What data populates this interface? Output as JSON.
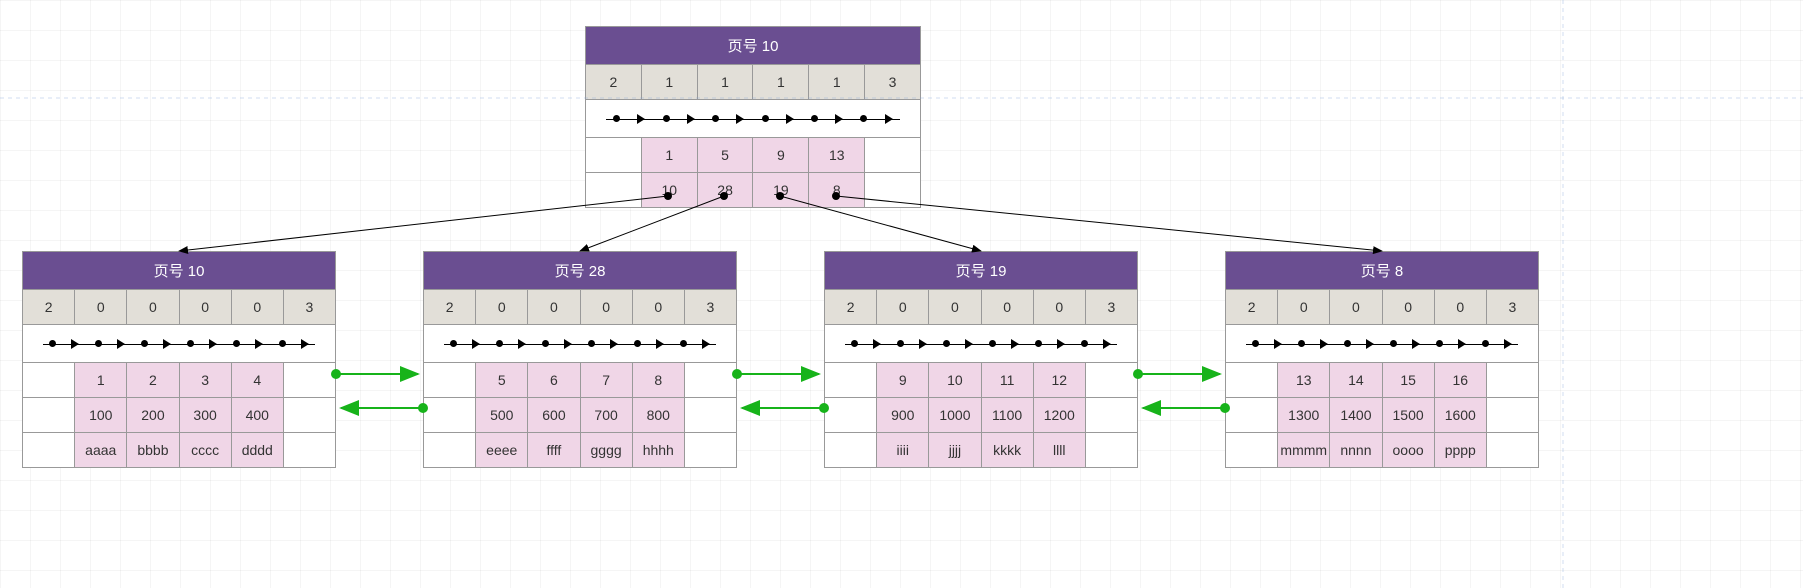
{
  "root": {
    "title": "页号 10",
    "header": [
      "2",
      "1",
      "1",
      "1",
      "1",
      "3"
    ],
    "rows": [
      [
        "",
        "1",
        "5",
        "9",
        "13",
        ""
      ],
      [
        "",
        "10",
        "28",
        "19",
        "8",
        ""
      ]
    ]
  },
  "leaves": [
    {
      "title": "页号 10",
      "header": [
        "2",
        "0",
        "0",
        "0",
        "0",
        "3"
      ],
      "rows": [
        [
          "",
          "1",
          "2",
          "3",
          "4",
          ""
        ],
        [
          "",
          "100",
          "200",
          "300",
          "400",
          ""
        ],
        [
          "",
          "aaaa",
          "bbbb",
          "cccc",
          "dddd",
          ""
        ]
      ]
    },
    {
      "title": "页号 28",
      "header": [
        "2",
        "0",
        "0",
        "0",
        "0",
        "3"
      ],
      "rows": [
        [
          "",
          "5",
          "6",
          "7",
          "8",
          ""
        ],
        [
          "",
          "500",
          "600",
          "700",
          "800",
          ""
        ],
        [
          "",
          "eeee",
          "ffff",
          "gggg",
          "hhhh",
          ""
        ]
      ]
    },
    {
      "title": "页号 19",
      "header": [
        "2",
        "0",
        "0",
        "0",
        "0",
        "3"
      ],
      "rows": [
        [
          "",
          "9",
          "10",
          "11",
          "12",
          ""
        ],
        [
          "",
          "900",
          "1000",
          "1100",
          "1200",
          ""
        ],
        [
          "",
          "iiii",
          "jjjj",
          "kkkk",
          "llll",
          ""
        ]
      ]
    },
    {
      "title": "页号 8",
      "header": [
        "2",
        "0",
        "0",
        "0",
        "0",
        "3"
      ],
      "rows": [
        [
          "",
          "13",
          "14",
          "15",
          "16",
          ""
        ],
        [
          "",
          "1300",
          "1400",
          "1500",
          "1600",
          ""
        ],
        [
          "",
          "mmmm",
          "nnnn",
          "oooo",
          "pppp",
          ""
        ]
      ]
    }
  ]
}
